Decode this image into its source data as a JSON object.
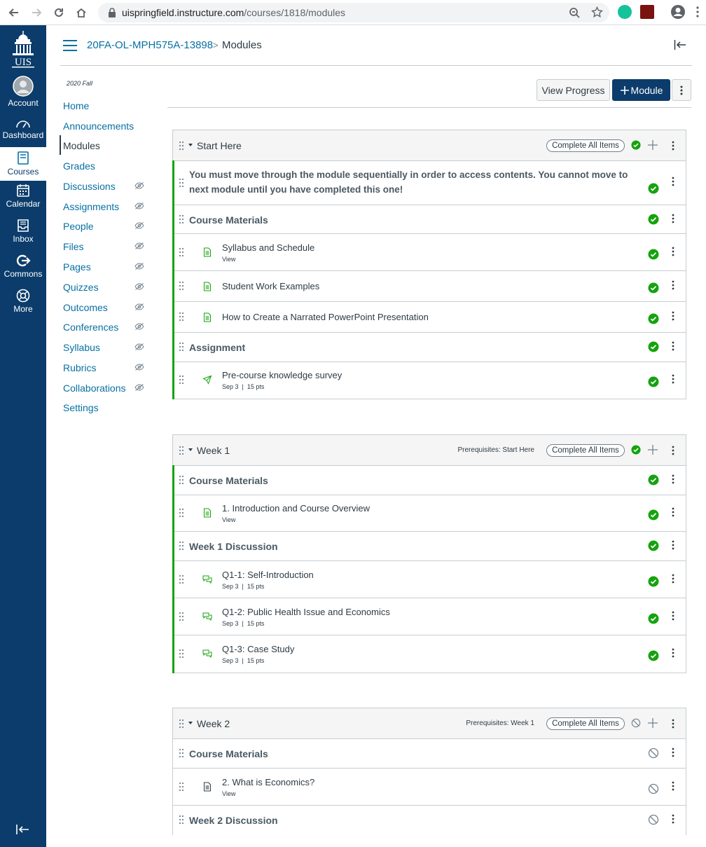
{
  "browser": {
    "url_host": "uispringfield.instructure.com",
    "url_path": "/courses/1818/modules"
  },
  "global_nav": {
    "logo": "UIS",
    "items": [
      {
        "label": "Account",
        "icon": "account-icon"
      },
      {
        "label": "Dashboard",
        "icon": "dashboard-icon"
      },
      {
        "label": "Courses",
        "icon": "courses-icon"
      },
      {
        "label": "Calendar",
        "icon": "calendar-icon"
      },
      {
        "label": "Inbox",
        "icon": "inbox-icon"
      },
      {
        "label": "Commons",
        "icon": "commons-icon"
      },
      {
        "label": "More",
        "icon": "more-icon"
      }
    ]
  },
  "header": {
    "course": "20FA-OL-MPH575A-13898",
    "separator": ">",
    "page": "Modules"
  },
  "course_nav": {
    "term": "2020 Fall",
    "items": [
      {
        "label": "Home"
      },
      {
        "label": "Announcements"
      },
      {
        "label": "Modules"
      },
      {
        "label": "Grades"
      },
      {
        "label": "Discussions"
      },
      {
        "label": "Assignments"
      },
      {
        "label": "People"
      },
      {
        "label": "Files"
      },
      {
        "label": "Pages"
      },
      {
        "label": "Quizzes"
      },
      {
        "label": "Outcomes"
      },
      {
        "label": "Conferences"
      },
      {
        "label": "Syllabus"
      },
      {
        "label": "Rubrics"
      },
      {
        "label": "Collaborations"
      },
      {
        "label": "Settings"
      }
    ]
  },
  "toolbar": {
    "view_progress": "View Progress",
    "add_module": "Module"
  },
  "modules": [
    {
      "title": "Start Here",
      "complete_all": "Complete All Items",
      "rows": [
        {
          "text": "You must move through the module sequentially in order to access contents. You cannot move to",
          "text2": "next module until you have completed this one!"
        },
        {
          "text": "Course Materials"
        },
        {
          "text": "Syllabus and Schedule",
          "meta": "View"
        },
        {
          "text": "Student Work Examples"
        },
        {
          "text": "How to Create a Narrated PowerPoint Presentation"
        },
        {
          "text": "Assignment"
        },
        {
          "text": "Pre-course knowledge survey",
          "meta": "Sep 3  |  15 pts"
        }
      ]
    },
    {
      "title": "Week 1",
      "prereq": "Prerequisites: Start Here",
      "complete_all": "Complete All Items",
      "rows": [
        {
          "text": "Course Materials"
        },
        {
          "text": "1. Introduction and Course Overview",
          "meta": "View"
        },
        {
          "text": "Week 1 Discussion"
        },
        {
          "text": "Q1-1: Self-Introduction",
          "meta": "Sep 3  |  15 pts"
        },
        {
          "text": "Q1-2: Public Health Issue and Economics",
          "meta": "Sep 3  |  15 pts"
        },
        {
          "text": "Q1-3: Case Study",
          "meta": "Sep 3  |  15 pts"
        }
      ]
    },
    {
      "title": "Week 2",
      "prereq": "Prerequisites: Week 1",
      "complete_all": "Complete All Items",
      "rows": [
        {
          "text": "Course Materials"
        },
        {
          "text": "2. What is Economics?",
          "meta": "View"
        },
        {
          "text": "Week 2 Discussion"
        }
      ]
    }
  ],
  "colors": {
    "nav_bg": "#0b3c6b",
    "link": "#0770a3",
    "complete_green": "#14a30d"
  }
}
